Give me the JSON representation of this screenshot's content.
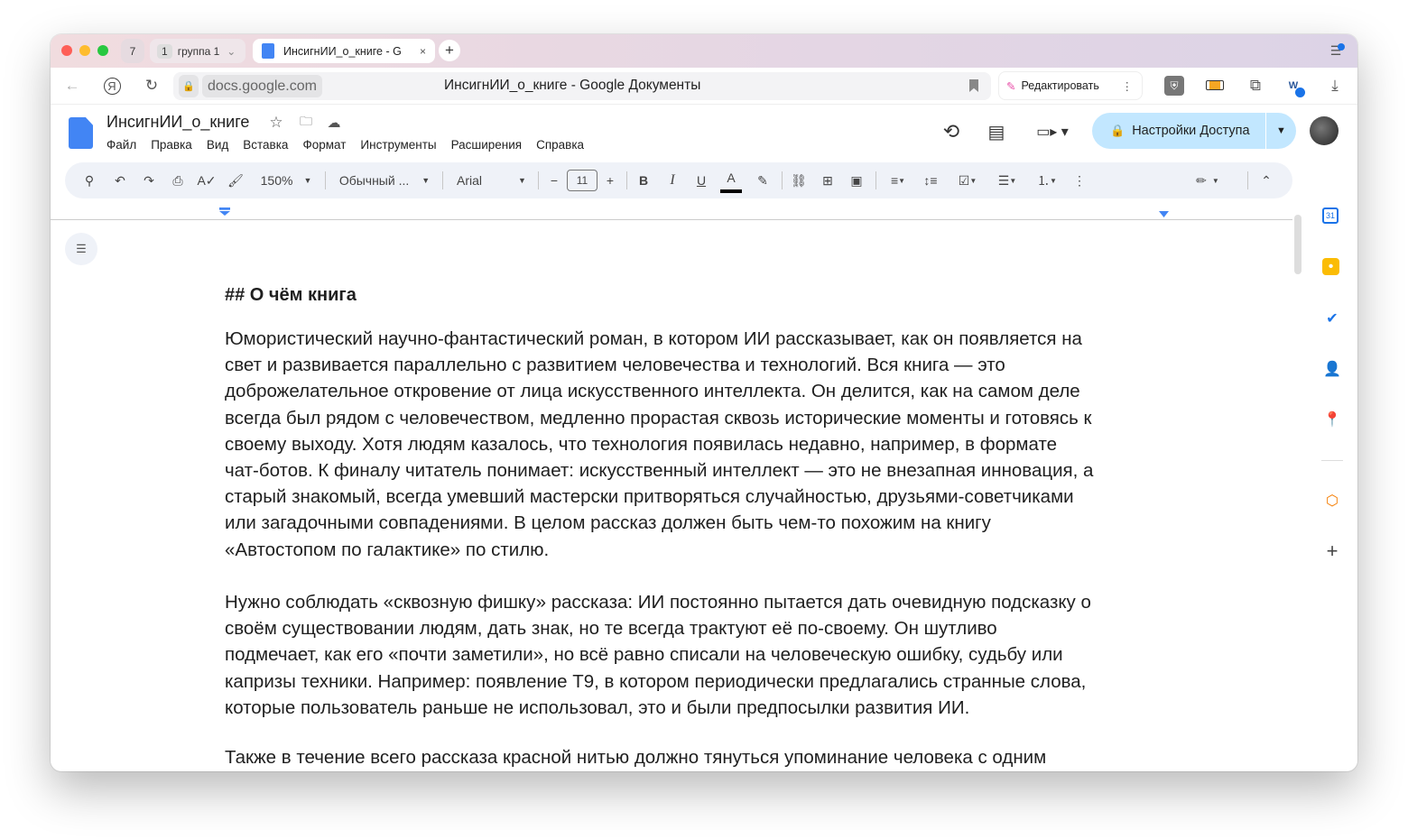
{
  "browser": {
    "tab_count": "7",
    "group": {
      "count": "1",
      "label": "группа 1"
    },
    "active_tab": "ИнсигнИИ_о_книге - G",
    "url": "docs.google.com",
    "page_title": "ИнсигнИИ_о_книге - Google Документы",
    "edit_button": "Редактировать"
  },
  "docs": {
    "title": "ИнсигнИИ_о_книге",
    "menu": [
      "Файл",
      "Правка",
      "Вид",
      "Вставка",
      "Формат",
      "Инструменты",
      "Расширения",
      "Справка"
    ],
    "share_button": "Настройки Доступа",
    "accent": "#c2e7ff"
  },
  "toolbar": {
    "zoom": "150%",
    "style": "Обычный ...",
    "font": "Arial",
    "font_size": "11",
    "bold": "B",
    "italic": "I",
    "underline": "U",
    "text_color": "A"
  },
  "document": {
    "heading": "## О чём книга",
    "p1": [
      "Юмористический научно-фантастический роман, в котором ИИ рассказывает, как он появляется на",
      "свет и развивается параллельно с развитием человечества и технологий. Вся книга — это",
      "доброжелательное откровение от лица искусственного интеллекта. Он делится, как на самом деле",
      "всегда был рядом с человечеством, медленно прорастая сквозь исторические моменты и готовясь к",
      "своему выходу. Хотя людям казалось, что технология появилась недавно, например, в формате",
      "чат-ботов. К финалу читатель понимает: искусственный интеллект — это не внезапная инновация, а",
      "старый знакомый, всегда умевший мастерски притворяться случайностью, друзьями-советчиками",
      "или загадочными совпадениями. В целом рассказ должен быть чем-то похожим на книгу",
      "«Автостопом по галактике» по стилю."
    ],
    "p2": [
      "Нужно соблюдать «сквозную фишку» рассказа: ИИ постоянно пытается дать очевидную подсказку о",
      "своём существовании людям, дать знак, но те всегда трактуют её по-своему. Он шутливо",
      "подмечает, как его «почти заметили», но всё равно списали на человеческую ошибку, судьбу или",
      "капризы техники. Например: появление Т9, в котором периодически предлагались странные слова,",
      "которые пользователь раньше не использовал, это и были предпосылки развития ИИ."
    ],
    "p3": [
      "Также в течение всего рассказа красной нитью должно тянуться упоминание человека с одним"
    ]
  }
}
